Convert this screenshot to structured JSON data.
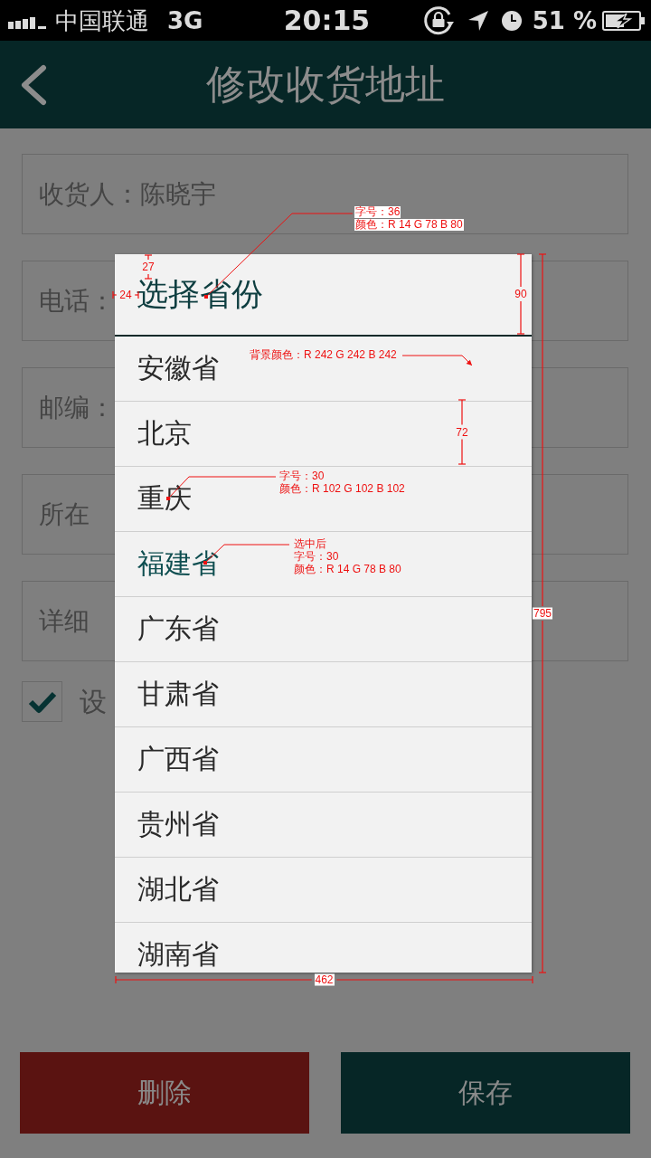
{
  "status_bar": {
    "carrier": "中国联通",
    "network": "3G",
    "time": "20:15",
    "battery": "51 %"
  },
  "nav_bar": {
    "title": "修改收货地址"
  },
  "form": {
    "fields": [
      {
        "label": "收货人：",
        "value": "陈晓宇"
      },
      {
        "label": "电话："
      },
      {
        "label": "邮编："
      },
      {
        "label": "所在"
      },
      {
        "label": "详细"
      }
    ],
    "default_option": {
      "label": "设",
      "checked": true
    }
  },
  "buttons": [
    {
      "label": "删除",
      "kind": "delete"
    },
    {
      "label": "保存",
      "kind": "save"
    }
  ],
  "dialog": {
    "title": "选择省份",
    "items": [
      {
        "label": "安徽省",
        "selected": false
      },
      {
        "label": "北京",
        "selected": false
      },
      {
        "label": "重庆",
        "selected": false
      },
      {
        "label": "福建省",
        "selected": true
      },
      {
        "label": "广东省",
        "selected": false
      },
      {
        "label": "甘肃省",
        "selected": false
      },
      {
        "label": "广西省",
        "selected": false
      },
      {
        "label": "贵州省",
        "selected": false
      },
      {
        "label": "湖北省",
        "selected": false
      },
      {
        "label": "湖南省",
        "selected": false
      }
    ]
  },
  "annotations": [
    {
      "kind": "callout",
      "lines": [
        "字号：36",
        "颜色：R 14 G 78 B 80"
      ]
    },
    {
      "kind": "height",
      "value": "27"
    },
    {
      "kind": "width",
      "value": "24"
    },
    {
      "kind": "height",
      "value": "90"
    },
    {
      "kind": "arrow",
      "lines": [
        "背景颜色：R 242 G 242 B 242"
      ]
    },
    {
      "kind": "height",
      "value": "72"
    },
    {
      "kind": "callout",
      "lines": [
        "字号：30",
        "颜色：R 102 G 102 B 102"
      ]
    },
    {
      "kind": "callout",
      "lines": [
        "选中后",
        "字号：30",
        "颜色：R 14 G 78 B 80"
      ]
    },
    {
      "kind": "height",
      "value": "795"
    },
    {
      "kind": "width",
      "value": "462"
    }
  ]
}
